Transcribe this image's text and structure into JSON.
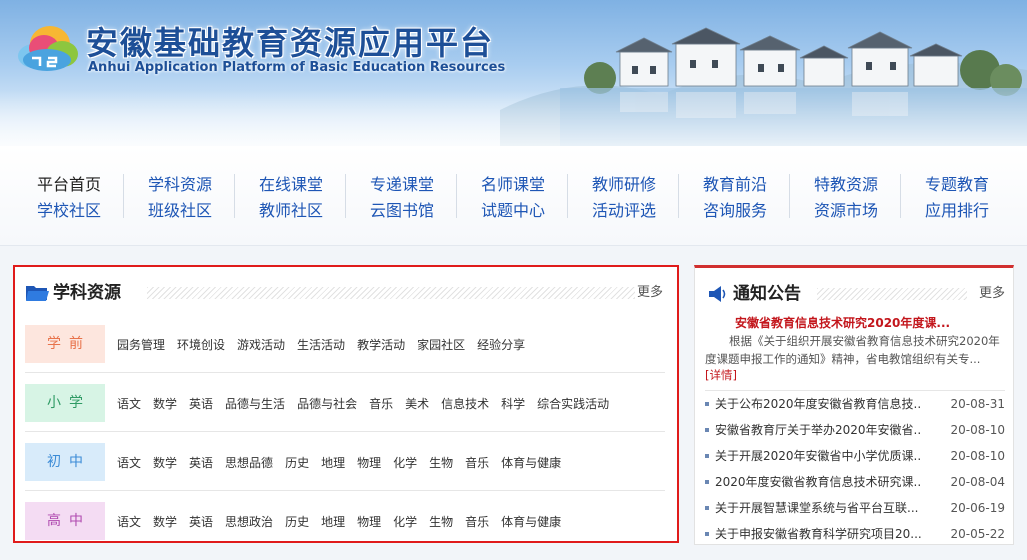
{
  "banner": {
    "title": "安徽基础教育资源应用平台",
    "subtitle": "Anhui Application Platform of Basic Education Resources"
  },
  "nav": [
    {
      "top": "平台首页",
      "bottom": "学校社区"
    },
    {
      "top": "学科资源",
      "bottom": "班级社区"
    },
    {
      "top": "在线课堂",
      "bottom": "教师社区"
    },
    {
      "top": "专递课堂",
      "bottom": "云图书馆"
    },
    {
      "top": "名师课堂",
      "bottom": "试题中心"
    },
    {
      "top": "教师研修",
      "bottom": "活动评选"
    },
    {
      "top": "教育前沿",
      "bottom": "咨询服务"
    },
    {
      "top": "特教资源",
      "bottom": "资源市场"
    },
    {
      "top": "专题教育",
      "bottom": "应用排行"
    }
  ],
  "subjects": {
    "title": "学科资源",
    "more": "更多",
    "rows": [
      {
        "label": "学前",
        "color": "#e8734b",
        "bg": "#fde6de",
        "items": [
          "园务管理",
          "环境创设",
          "游戏活动",
          "生活活动",
          "教学活动",
          "家园社区",
          "经验分享"
        ]
      },
      {
        "label": "小学",
        "color": "#2e9a64",
        "bg": "#d7f4e5",
        "items": [
          "语文",
          "数学",
          "英语",
          "品德与生活",
          "品德与社会",
          "音乐",
          "美术",
          "信息技术",
          "科学",
          "综合实践活动"
        ]
      },
      {
        "label": "初中",
        "color": "#3b8bd6",
        "bg": "#d8ebfa",
        "items": [
          "语文",
          "数学",
          "英语",
          "思想品德",
          "历史",
          "地理",
          "物理",
          "化学",
          "生物",
          "音乐",
          "体育与健康"
        ]
      },
      {
        "label": "高中",
        "color": "#b04bb0",
        "bg": "#f4dcf3",
        "items": [
          "语文",
          "数学",
          "英语",
          "思想政治",
          "历史",
          "地理",
          "物理",
          "化学",
          "生物",
          "音乐",
          "体育与健康"
        ]
      }
    ]
  },
  "notice": {
    "title": "通知公告",
    "more": "更多",
    "featured": {
      "title": "安徽省教育信息技术研究2020年度课...",
      "body": "根据《关于组织开展安徽省教育信息技术研究2020年度课题申报工作的通知》精神，省电教馆组织有关专...",
      "detail": "[详情]"
    },
    "items": [
      {
        "title": "关于公布2020年度安徽省教育信息技...",
        "date": "20-08-31"
      },
      {
        "title": "安徽省教育厅关于举办2020年安徽省...",
        "date": "20-08-10"
      },
      {
        "title": "关于开展2020年安徽省中小学优质课...",
        "date": "20-08-10"
      },
      {
        "title": "2020年度安徽省教育信息技术研究课...",
        "date": "20-08-04"
      },
      {
        "title": "关于开展智慧课堂系统与省平台互联...",
        "date": "20-06-19"
      },
      {
        "title": "关于申报安徽省教育科学研究项目20...",
        "date": "20-05-22"
      }
    ]
  },
  "colors": {
    "accent": "#1e56b5",
    "panel_border": "#e01b1b",
    "notice_red": "#c3161c"
  }
}
